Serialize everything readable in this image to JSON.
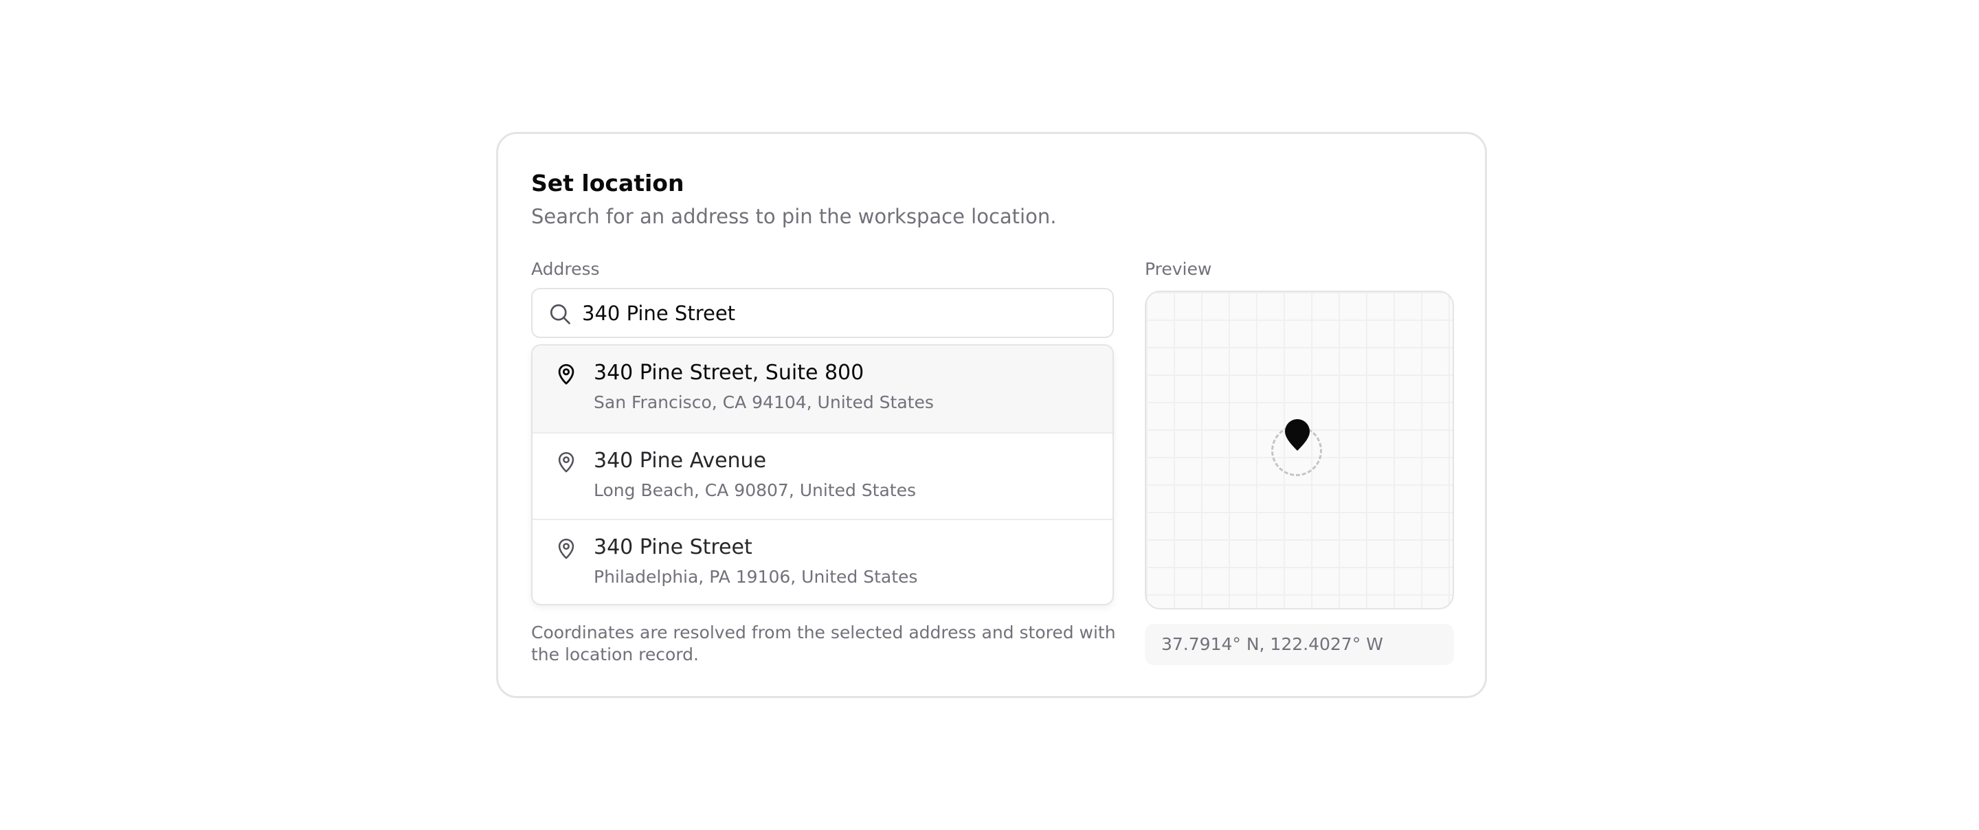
{
  "card": {
    "title": "Set location",
    "subtitle": "Search for an address to pin the workspace location."
  },
  "address": {
    "label": "Address",
    "search_value": "340 Pine Street",
    "search_icon": "search-icon",
    "suggestions": [
      {
        "line1": "340 Pine Street, Suite 800",
        "line2": "San Francisco, CA 94104, United States",
        "icon": "map-pin-icon",
        "selected": true
      },
      {
        "line1": "340 Pine Avenue",
        "line2": "Long Beach, CA 90807, United States",
        "icon": "map-pin-icon",
        "selected": false
      },
      {
        "line1": "340 Pine Street",
        "line2": "Philadelphia, PA 19106, United States",
        "icon": "map-pin-icon",
        "selected": false
      }
    ],
    "footnote": "Coordinates are resolved from the selected address and stored with the location record."
  },
  "preview": {
    "label": "Preview",
    "marker_icon": "map-marker-icon",
    "coordinates": "37.7914° N, 122.4027° W"
  },
  "colors": {
    "text_primary": "#0a0a0a",
    "text_muted": "#71717a",
    "border": "#e4e4e7",
    "highlight": "#f7f7f8"
  }
}
